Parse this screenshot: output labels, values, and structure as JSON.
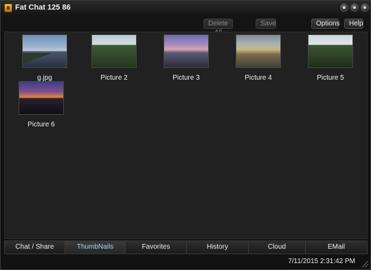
{
  "window": {
    "title": "Fat Chat 125 86"
  },
  "toolbar": {
    "delete_all_label": "Delete All",
    "save_label": "Save",
    "options_label": "Options",
    "help_label": "Help"
  },
  "thumbnails": [
    {
      "caption": "g.jpg"
    },
    {
      "caption": "Picture 2"
    },
    {
      "caption": "Picture 3"
    },
    {
      "caption": "Picture 4"
    },
    {
      "caption": "Picture 5"
    },
    {
      "caption": "Picture 6"
    }
  ],
  "tabs": [
    {
      "label": "Chat / Share"
    },
    {
      "label": "ThumbNails"
    },
    {
      "label": "Favorites"
    },
    {
      "label": "History"
    },
    {
      "label": "Cloud"
    },
    {
      "label": "EMail"
    }
  ],
  "active_tab": "ThumbNails",
  "status": {
    "datetime": "7/11/2015 2:31:42 PM"
  },
  "colors": {
    "active_tab_text": "#9fd6ff",
    "background": "#212121"
  }
}
